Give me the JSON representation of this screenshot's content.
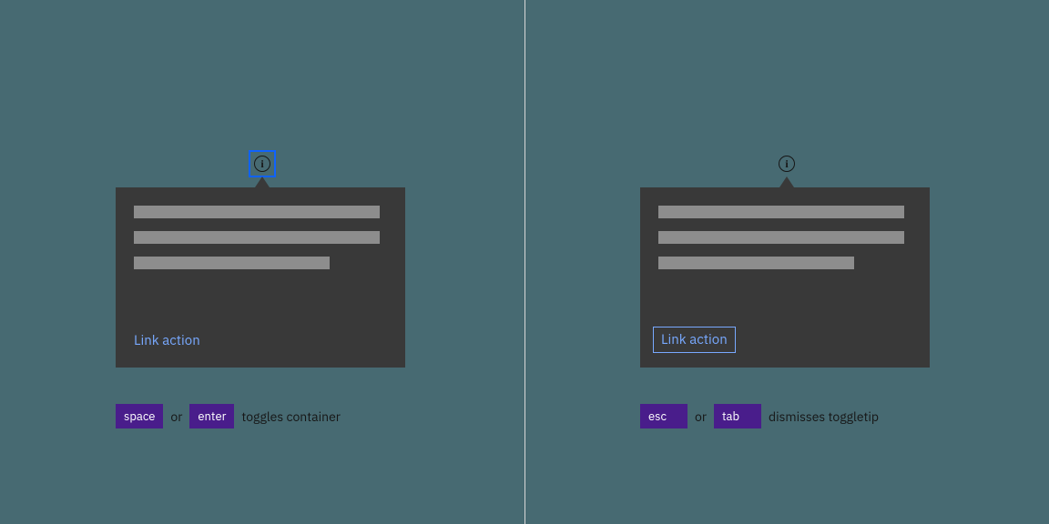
{
  "left": {
    "info_glyph": "i",
    "link_label": "Link action",
    "key1": "space",
    "conj": "or",
    "key2": "enter",
    "caption_tail": "toggles container"
  },
  "right": {
    "info_glyph": "i",
    "link_label": "Link action",
    "key1": "esc",
    "conj": "or",
    "key2": "tab",
    "caption_tail": "dismisses toggletip"
  }
}
